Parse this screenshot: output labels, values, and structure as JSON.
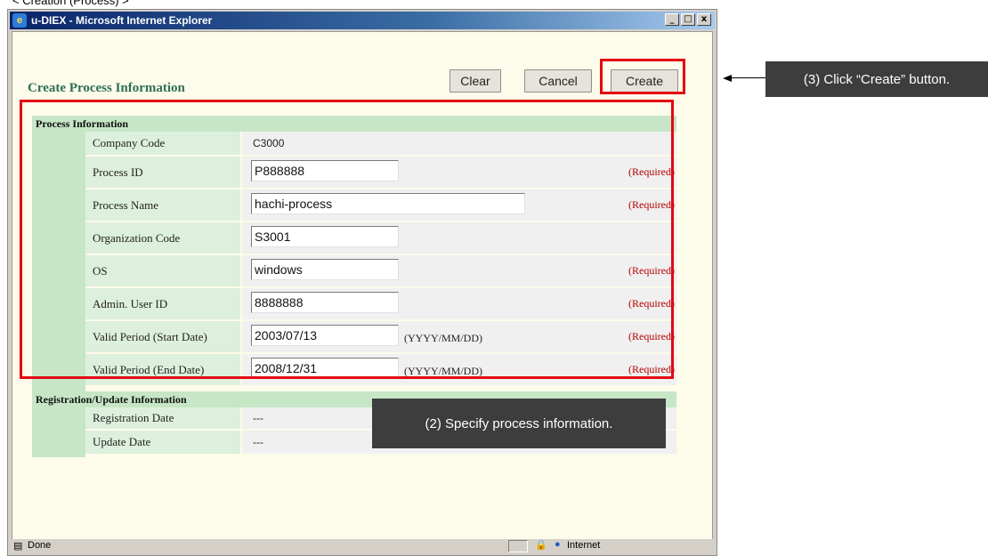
{
  "caption": "< Creation (Process) >",
  "window": {
    "title": "u-DIEX - Microsoft Internet Explorer",
    "controls": {
      "minimize": "_",
      "maximize": "□",
      "close": "x"
    }
  },
  "page": {
    "title": "Create Process Information",
    "buttons": {
      "clear": "Clear",
      "cancel": "Cancel",
      "create": "Create"
    }
  },
  "process_section": {
    "header": "Process Information",
    "rows": [
      {
        "label": "Company Code",
        "value": "C3000"
      },
      {
        "label": "Process ID",
        "value": "P888888",
        "required": "(Required)"
      },
      {
        "label": "Process Name",
        "value": "hachi-process",
        "required": "(Required)"
      },
      {
        "label": "Organization Code",
        "value": "S3001"
      },
      {
        "label": "OS",
        "value": "windows",
        "required": "(Required)"
      },
      {
        "label": "Admin. User ID",
        "value": "8888888",
        "required": "(Required)"
      },
      {
        "label": "Valid Period  (Start Date)",
        "value": "2003/07/13",
        "format": "(YYYY/MM/DD)",
        "required": "(Required)"
      },
      {
        "label": "Valid Period  (End Date)",
        "value": "2008/12/31",
        "format": "(YYYY/MM/DD)",
        "required": "(Required)"
      }
    ]
  },
  "registration_section": {
    "header": "Registration/Update Information",
    "rows": [
      {
        "label": "Registration Date",
        "value": "---"
      },
      {
        "label": "Update Date",
        "value": "---"
      }
    ]
  },
  "annotations": {
    "click_create": "(3) Click “Create” button.",
    "specify_info": "(2) Specify process information."
  },
  "statusbar": {
    "status": "Done",
    "zone": "Internet"
  },
  "colors": {
    "accent_red": "#e30613",
    "section_green": "#c6e6c6",
    "title_green": "#2e6f57",
    "required_red": "#b40000"
  }
}
